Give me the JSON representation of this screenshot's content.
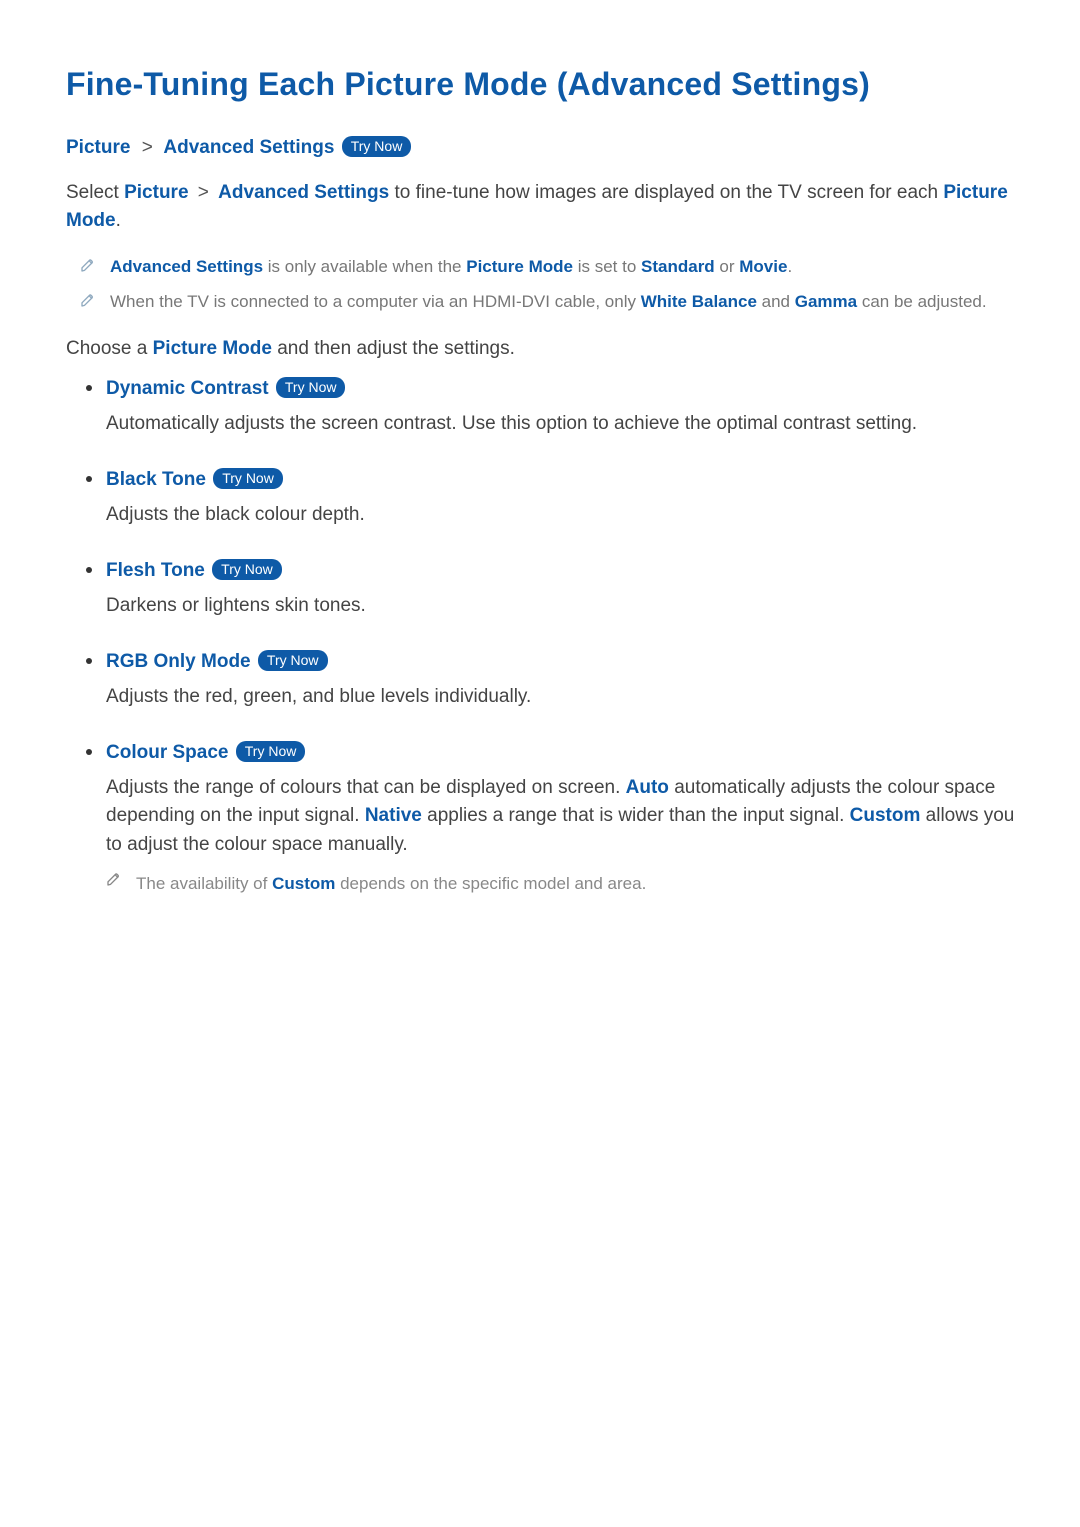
{
  "title": "Fine-Tuning Each Picture Mode (Advanced Settings)",
  "breadcrumb": {
    "a": "Picture",
    "sep": ">",
    "b": "Advanced Settings",
    "try": "Try Now"
  },
  "try_now": "Try Now",
  "intro": {
    "pre": "Select ",
    "a": "Picture",
    "sep": " > ",
    "b": "Advanced Settings",
    "mid": " to fine-tune how images are displayed on the TV screen for each ",
    "c": "Picture Mode",
    "post": "."
  },
  "notes": [
    {
      "parts": [
        {
          "t": "Advanced Settings",
          "blue": true
        },
        {
          "t": " is only available when the "
        },
        {
          "t": "Picture Mode",
          "blue": true
        },
        {
          "t": " is set to "
        },
        {
          "t": "Standard",
          "blue": true
        },
        {
          "t": " or "
        },
        {
          "t": "Movie",
          "blue": true
        },
        {
          "t": "."
        }
      ]
    },
    {
      "parts": [
        {
          "t": "When the TV is connected to a computer via an HDMI-DVI cable, only "
        },
        {
          "t": "White Balance",
          "blue": true
        },
        {
          "t": " and "
        },
        {
          "t": "Gamma",
          "blue": true
        },
        {
          "t": " can be adjusted."
        }
      ]
    }
  ],
  "choose": {
    "pre": "Choose a ",
    "a": "Picture Mode",
    "post": " and then adjust the settings."
  },
  "items": [
    {
      "name": "dynamic-contrast",
      "title": "Dynamic Contrast",
      "desc": [
        {
          "t": "Automatically adjusts the screen contrast. Use this option to achieve the optimal contrast setting."
        }
      ]
    },
    {
      "name": "black-tone",
      "title": "Black Tone",
      "desc": [
        {
          "t": "Adjusts the black colour depth."
        }
      ]
    },
    {
      "name": "flesh-tone",
      "title": "Flesh Tone",
      "desc": [
        {
          "t": "Darkens or lightens skin tones."
        }
      ]
    },
    {
      "name": "rgb-only-mode",
      "title": "RGB Only Mode",
      "desc": [
        {
          "t": "Adjusts the red, green, and blue levels individually."
        }
      ]
    },
    {
      "name": "colour-space",
      "title": "Colour Space",
      "desc": [
        {
          "t": "Adjusts the range of colours that can be displayed on screen. "
        },
        {
          "t": "Auto",
          "blue": true
        },
        {
          "t": " automatically adjusts the colour space depending on the input signal. "
        },
        {
          "t": "Native",
          "blue": true
        },
        {
          "t": " applies a range that is wider than the input signal. "
        },
        {
          "t": "Custom",
          "blue": true
        },
        {
          "t": " allows you to adjust the colour space manually."
        }
      ],
      "subnote": [
        {
          "t": "The availability of "
        },
        {
          "t": "Custom",
          "blue": true
        },
        {
          "t": " depends on the specific model and area."
        }
      ]
    }
  ]
}
